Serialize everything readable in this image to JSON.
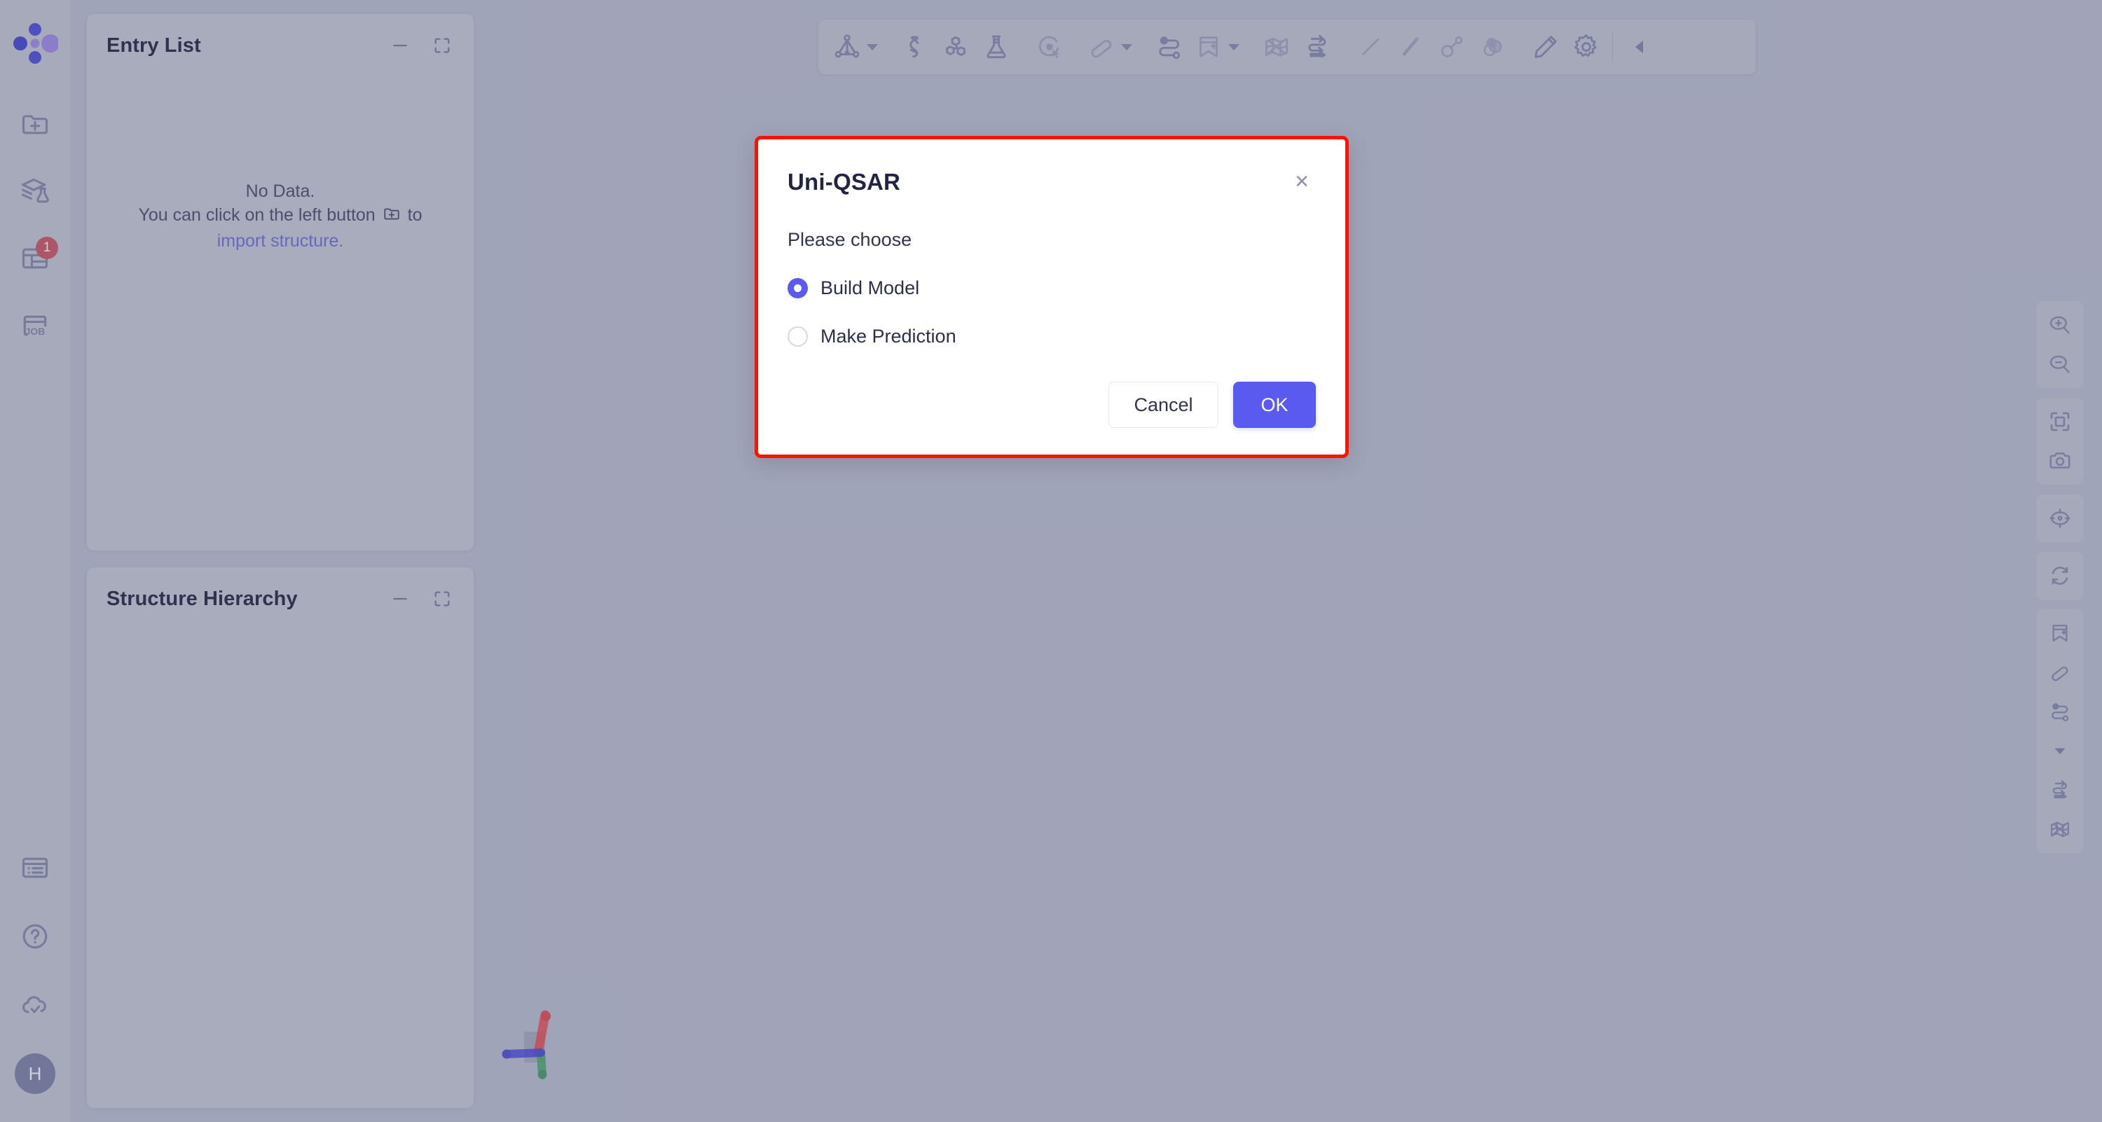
{
  "app": {
    "logo_name": "uni-lab-logo",
    "background_color": "#b2b5c7",
    "panel_color": "#bdbfcc"
  },
  "sidebar": {
    "top_items": [
      {
        "name": "import-structure-icon",
        "label": "Import Structure",
        "badge": null
      },
      {
        "name": "model-library-icon",
        "label": "Model Library",
        "badge": null
      },
      {
        "name": "data-table-icon",
        "label": "Data Table",
        "badge": "1"
      },
      {
        "name": "job-icon",
        "label": "Job",
        "badge": null
      }
    ],
    "bottom_items": [
      {
        "name": "console-icon",
        "label": "Console"
      },
      {
        "name": "help-icon",
        "label": "Help"
      },
      {
        "name": "cloud-check-icon",
        "label": "Cloud Sync"
      }
    ],
    "avatar": {
      "name": "user-avatar",
      "initial": "H"
    }
  },
  "panels": [
    {
      "id": "entry-list",
      "title": "Entry List",
      "minimize_label": "Minimize",
      "expand_label": "Expand",
      "empty": {
        "line1": "No Data.",
        "line2_prefix": "You can click on the left button",
        "line2_suffix": "to",
        "link": "import structure.",
        "icon": "folder-plus-icon"
      }
    },
    {
      "id": "structure-hierarchy",
      "title": "Structure Hierarchy",
      "minimize_label": "Minimize",
      "expand_label": "Expand"
    }
  ],
  "toolbar": {
    "items": [
      {
        "name": "molecule-structure-icon",
        "label": "Structure",
        "caret": true
      },
      {
        "name": "protein-helix-icon",
        "label": "Protein",
        "caret": false
      },
      {
        "name": "ligand-ring-icon",
        "label": "Ligand",
        "caret": false
      },
      {
        "name": "flask-icon",
        "label": "Experiment",
        "caret": false
      },
      {
        "name": "select-pointer-icon",
        "label": "Select",
        "caret": false
      },
      {
        "name": "eraser-icon",
        "label": "Eraser",
        "caret": true
      },
      {
        "name": "chain-link-icon",
        "label": "Link",
        "caret": false
      },
      {
        "name": "bookmark-plus-icon",
        "label": "Bookmark",
        "caret": true
      },
      {
        "name": "surface-mesh-icon",
        "label": "Surface",
        "caret": false
      },
      {
        "name": "swap-arrows-icon",
        "label": "Swap",
        "caret": false
      },
      {
        "name": "line-thin-icon",
        "label": "Line",
        "caret": false
      },
      {
        "name": "stick-icon",
        "label": "Stick",
        "caret": false
      },
      {
        "name": "ball-stick-icon",
        "label": "Ball and Stick",
        "caret": false
      },
      {
        "name": "spacefill-icon",
        "label": "Spacefill",
        "caret": false
      },
      {
        "name": "pencil-icon",
        "label": "Edit",
        "caret": false
      },
      {
        "name": "gear-icon",
        "label": "Settings",
        "caret": false
      }
    ],
    "collapse_label": "Collapse toolbar"
  },
  "right_tools": {
    "groups": [
      {
        "items": [
          {
            "name": "zoom-in-icon",
            "label": "Zoom In"
          },
          {
            "name": "zoom-out-icon",
            "label": "Zoom Out"
          }
        ]
      },
      {
        "items": [
          {
            "name": "fit-screen-icon",
            "label": "Fit to Screen"
          },
          {
            "name": "camera-icon",
            "label": "Screenshot"
          }
        ]
      },
      {
        "items": [
          {
            "name": "center-target-icon",
            "label": "Center View"
          }
        ]
      },
      {
        "items": [
          {
            "name": "refresh-icon",
            "label": "Reset View"
          }
        ]
      },
      {
        "items": [
          {
            "name": "bookmark-plus-icon",
            "label": "Add Bookmark"
          },
          {
            "name": "eraser-icon",
            "label": "Eraser"
          },
          {
            "name": "chain-link-icon",
            "label": "Link"
          },
          {
            "name": "chevron-down-icon",
            "label": "More"
          },
          {
            "name": "swap-arrows-icon",
            "label": "Swap"
          },
          {
            "name": "surface-mesh-icon",
            "label": "Surface"
          }
        ]
      }
    ]
  },
  "gizmo": {
    "name": "axis-gizmo",
    "axes": [
      {
        "axis": "x",
        "color": "#4747d8"
      },
      {
        "axis": "y",
        "color": "#3f9e63"
      },
      {
        "axis": "z",
        "color": "#e04a52"
      }
    ]
  },
  "modal": {
    "title": "Uni-QSAR",
    "close_label": "×",
    "prompt": "Please choose",
    "options": [
      {
        "label": "Build Model",
        "selected": true
      },
      {
        "label": "Make Prediction",
        "selected": false
      }
    ],
    "cancel_label": "Cancel",
    "ok_label": "OK",
    "highlight_color": "#fb1305",
    "accent_color": "#5a5af0"
  }
}
